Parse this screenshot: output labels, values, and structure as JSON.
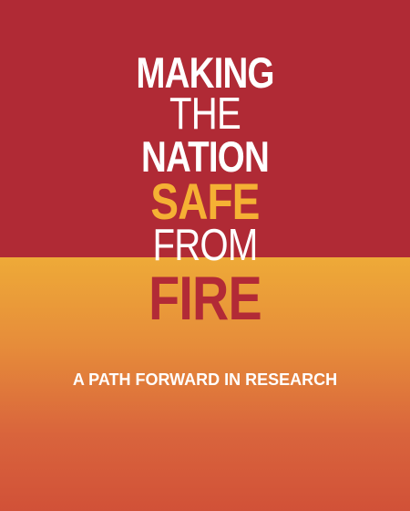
{
  "cover": {
    "title_lines": [
      "MAKING",
      "THE",
      "NATION",
      "SAFE",
      "FROM",
      "FIRE"
    ],
    "subtitle": "A PATH FORWARD IN RESEARCH"
  },
  "colors": {
    "top_background": "#b02a35",
    "bottom_gradient_top": "#eeaa38",
    "bottom_gradient_bottom": "#d15138",
    "title_white": "#ffffff",
    "title_accent_yellow": "#f5b134",
    "title_accent_red": "#b22a36"
  }
}
